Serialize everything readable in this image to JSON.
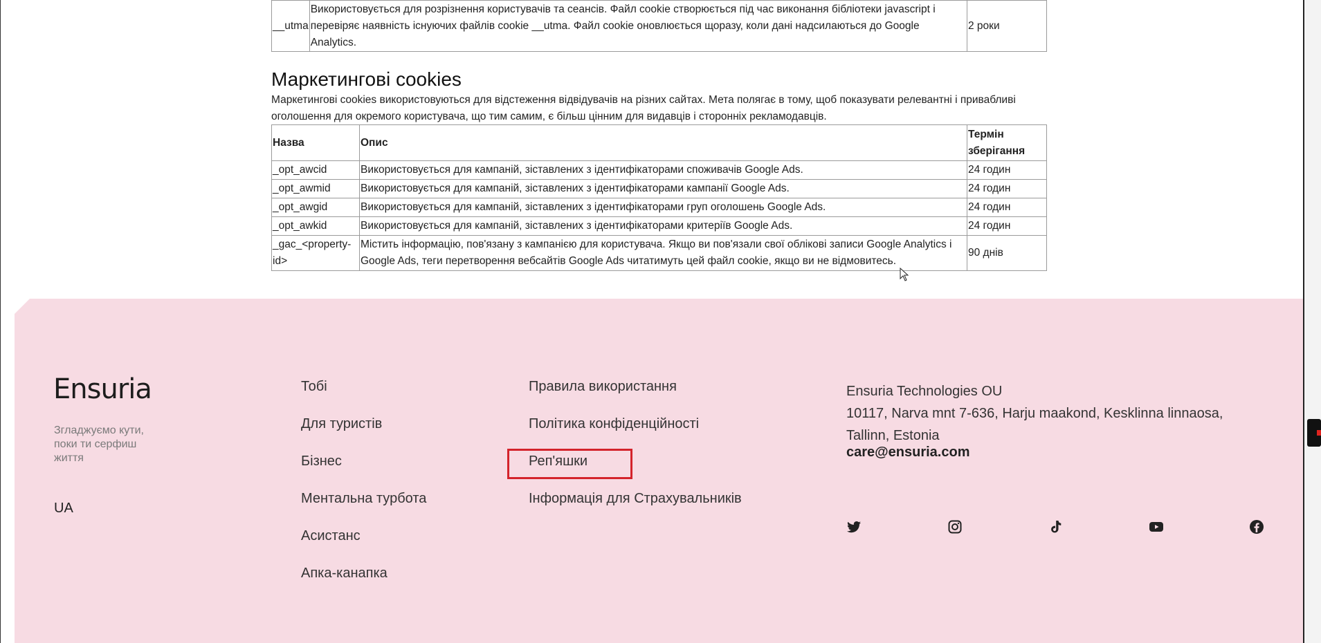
{
  "top_table": {
    "name": "__utma",
    "description": "Використовується для розрізнення користувачів та сеансів. Файл cookie створюється під час виконання бібліотеки javascript і перевіряє наявність існуючих файлів cookie __utma. Файл cookie оновлюється щоразу, коли дані надсилаються до Google Analytics.",
    "duration": "2 роки"
  },
  "marketing": {
    "title": "Маркетингові cookies",
    "description": "Маркетингові cookies використовуються для відстеження відвідувачів на різних сайтах. Мета полягає в тому, щоб показувати релевантні і привабливі оголошення для окремого користувача, що тим самим, є більш цінним для видавців і сторонніх рекламодавців.",
    "headers": {
      "name": "Назва",
      "description": "Опис",
      "duration": "Термін зберігання"
    },
    "rows": [
      {
        "name": "_opt_awcid",
        "description": "Використовується для кампаній, зіставлених з ідентифікаторами споживачів Google Ads.",
        "duration": "24 годин"
      },
      {
        "name": "_opt_awmid",
        "description": "Використовується для кампаній, зіставлених з ідентифікаторами кампанії Google Ads.",
        "duration": "24 годин"
      },
      {
        "name": "_opt_awgid",
        "description": "Використовується для кампаній, зіставлених з ідентифікаторами груп оголошень Google Ads.",
        "duration": "24 годин"
      },
      {
        "name": "_opt_awkid",
        "description": "Використовується для кампаній, зіставлених з ідентифікаторами критеріїв Google Ads.",
        "duration": "24 годин"
      },
      {
        "name": "_gac_<property-id>",
        "description": "Містить інформацію, пов'язану з кампанією для користувача. Якщо ви пов'язали свої облікові записи Google Analytics і Google Ads, теги перетворення вебсайтів Google Ads читатимуть цей файл cookie, якщо ви не відмовитесь.",
        "duration": "90 днів"
      }
    ]
  },
  "footer": {
    "logo": "Ensuria",
    "tagline": "Згладжуємо кути, поки ти серфиш життя",
    "language": "UA",
    "col1": [
      "Тобі",
      "Для туристів",
      "Бізнес",
      "Ментальна турбота",
      "Асистанс",
      "Апка-канапка"
    ],
    "col2": [
      "Правила використання",
      "Політика конфіденційності",
      "Реп'яшки",
      "Інформація для Страхувальників"
    ],
    "company_name": "Ensuria Technologies OU",
    "address": "10117, Narva mnt 7-636, Harju maakond, Kesklinna linnaosa, Tallinn, Estonia",
    "email": "care@ensuria.com",
    "social": [
      "twitter-icon",
      "instagram-icon",
      "tiktok-icon",
      "youtube-icon",
      "facebook-icon"
    ]
  },
  "colors": {
    "footer_bg": "#f7dbe3",
    "highlight": "#d4232b",
    "text": "#222222"
  }
}
